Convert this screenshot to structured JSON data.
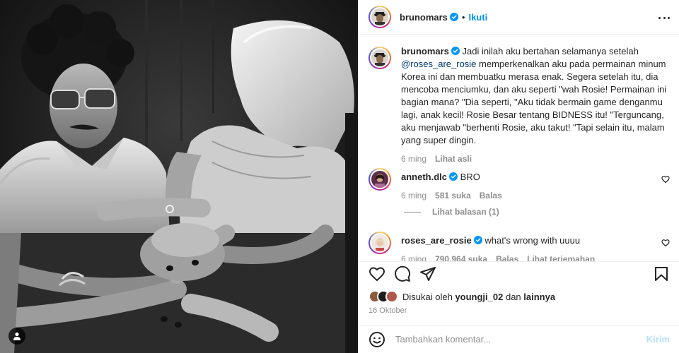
{
  "header": {
    "username": "brunomars",
    "dot": "•",
    "follow_label": "Ikuti"
  },
  "caption": {
    "username": "brunomars",
    "text_before": "Jadi inilah aku bertahan selamanya setelah ",
    "mention": "@roses_are_rosie",
    "text_after": " memperkenalkan aku pada permainan minum Korea ini dan membuatku merasa enak. Segera setelah itu, dia mencoba menciumku, dan aku seperti \"wah Rosie! Permainan ini bagian mana? \"Dia seperti, \"Aku tidak bermain game denganmu lagi, anak kecil! Rosie Besar tentang BIDNESS itu! \"Terguncang, aku menjawab \"berhenti Rosie, aku takut! \"Tapi selain itu, malam yang super dingin.",
    "time": "6 ming",
    "see_translation": "Lihat asli"
  },
  "comments": [
    {
      "username": "anneth.dlc",
      "text": "BRO",
      "time": "6 ming",
      "likes": "581 suka",
      "reply": "Balas",
      "view_replies": "Lihat balasan (1)"
    },
    {
      "username": "roses_are_rosie",
      "text": "what's wrong with uuuu",
      "time": "6 ming",
      "likes": "790.964 suka",
      "reply": "Balas",
      "see_translation": "Lihat terjemahan"
    }
  ],
  "likes_line": {
    "prefix": "Disukai oleh ",
    "user": "youngji_02",
    "middle": " dan ",
    "others": "lainnya"
  },
  "date": "16 Oktober",
  "add_comment": {
    "placeholder": "Tambahkan komentar...",
    "post_label": "Kirim"
  },
  "icons": {
    "more": "more-options-icon",
    "heart": "heart-icon",
    "comment": "comment-icon",
    "share": "share-icon",
    "save": "bookmark-icon",
    "emoji": "emoji-icon",
    "tag": "user-tag-icon",
    "verified": "verified-badge-icon"
  },
  "colors": {
    "link": "#0095f6",
    "mention": "#00376b",
    "muted": "#8e8e8e",
    "verified": "#0095f6"
  }
}
